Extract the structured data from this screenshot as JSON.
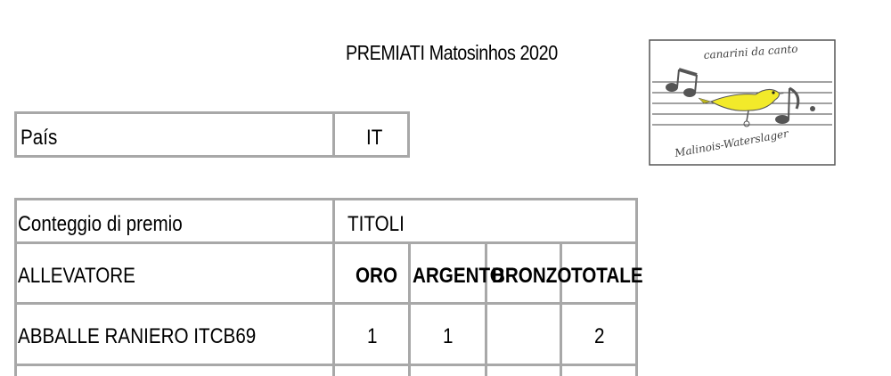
{
  "title": "PREMIATI Matosinhos 2020",
  "country_table": {
    "label": "País",
    "value": "IT"
  },
  "prize_table": {
    "row1": {
      "label": "Conteggio di premio",
      "value": "TITOLI"
    },
    "headers": {
      "breeder": "ALLEVATORE",
      "gold": "ORO",
      "silver": "ARGENTO",
      "bronze": "BRONZO",
      "total": "TOTALE"
    },
    "rows": [
      {
        "breeder": "ABBALLE RANIERO  ITCB69",
        "gold": "1",
        "silver": "1",
        "bronze": "",
        "total": "2"
      }
    ]
  },
  "logo": {
    "top_text": "canarini da canto",
    "bottom_text": "Malinois-Waterslager",
    "bird_color": "#f2ea2a"
  }
}
